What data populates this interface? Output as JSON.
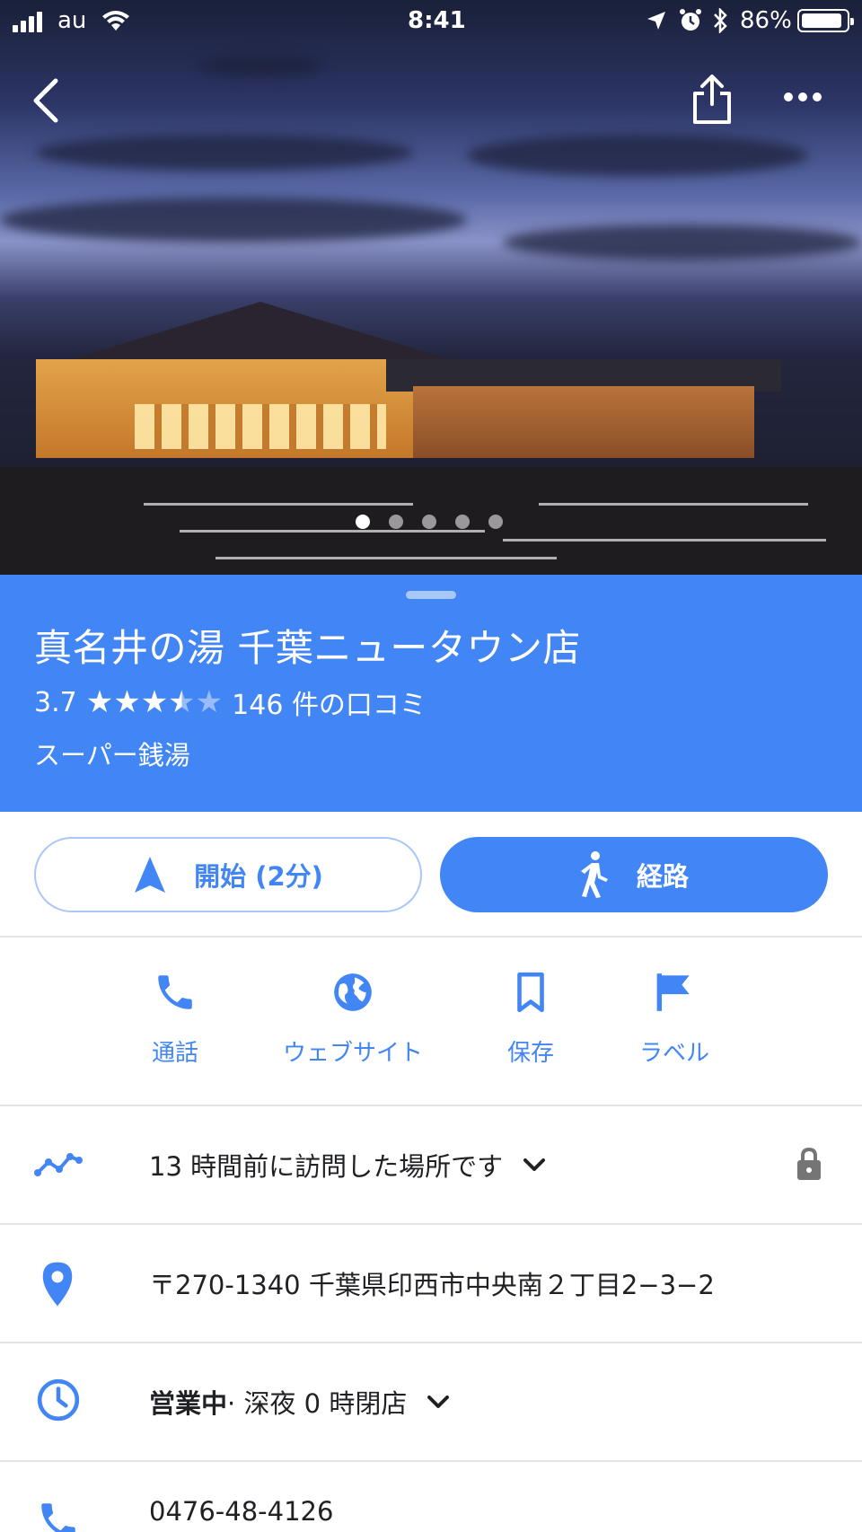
{
  "status_bar": {
    "carrier": "au",
    "time": "8:41",
    "battery": "86%"
  },
  "photo": {
    "page_count": 5,
    "active_index": 0
  },
  "place": {
    "name": "真名井の湯 千葉ニュータウン店",
    "rating": "3.7",
    "rating_value": 3.7,
    "reviews": "146 件の口コミ",
    "category": "スーパー銭湯"
  },
  "actions": {
    "start_label": "開始 (2分)",
    "route_label": "経路"
  },
  "quick_actions": [
    {
      "label": "通話",
      "icon": "phone-icon"
    },
    {
      "label": "ウェブサイト",
      "icon": "globe-icon"
    },
    {
      "label": "保存",
      "icon": "bookmark-icon"
    },
    {
      "label": "ラベル",
      "icon": "flag-icon"
    }
  ],
  "info": {
    "visited": "13 時間前に訪問した場所です",
    "address": "〒270-1340 千葉県印西市中央南２丁目2−3−2",
    "hours_status": "営業中",
    "hours_detail": " · 深夜 0 時閉店",
    "phone": "0476-48-4126"
  },
  "colors": {
    "accent": "#4285f4",
    "header_bg": "#4285f4"
  }
}
